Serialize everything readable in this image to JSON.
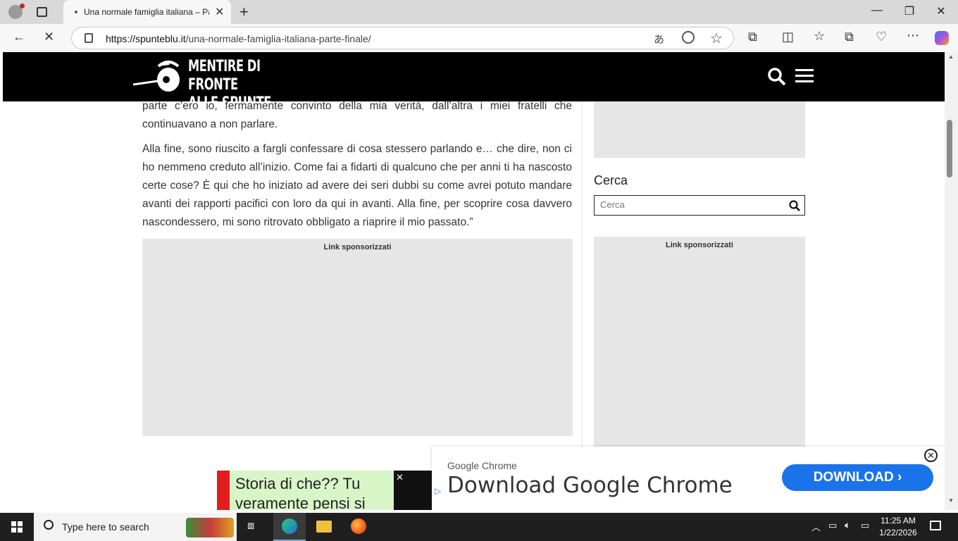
{
  "browser": {
    "tab_title": "Una normale famiglia italiana – Pa",
    "url_host": "https://spunteblu.it",
    "url_path": "/una-normale-famiglia-italiana-parte-finale/"
  },
  "site": {
    "logo_line1": "MENTIRE DI FRONTE",
    "logo_line2": "ALLE SPUNTE BLU"
  },
  "article": {
    "para1": "parte c’ero io, fermamente convinto della mia verità, dall’altra i miei fratelli che continuavano a non parlare.",
    "para2": "Alla fine, sono riuscito a fargli confessare di cosa stessero parlando e… che dire, non ci ho nemmeno creduto all’inizio. Come fai a fidarti di qualcuno che per anni ti ha nascosto certe cose? È qui che ho iniziato ad avere dei seri dubbi su come avrei potuto mandare avanti dei rapporti pacifici con loro da qui in avanti. Alla fine, per scoprire cosa davvero nascondessero, mi sono ritrovato obbligato a riaprire il mio passato.”",
    "ad_label": "Link sponsorizzati"
  },
  "sidebar": {
    "search_title": "Cerca",
    "search_placeholder": "Cerca",
    "ad_label": "Link sponsorizzati"
  },
  "ads": {
    "green_text": "Storia di che?? Tu veramente pensi si",
    "chrome_small": "Google Chrome",
    "chrome_big": "Download Google Chrome",
    "chrome_button": "DOWNLOAD"
  },
  "taskbar": {
    "search_placeholder": "Type here to search",
    "time": "11:25 AM",
    "date": "1/22/2026"
  },
  "colors": {
    "header_bg": "#000000",
    "ad_gray": "#e6e6e6",
    "chrome_blue": "#1a73e8"
  }
}
